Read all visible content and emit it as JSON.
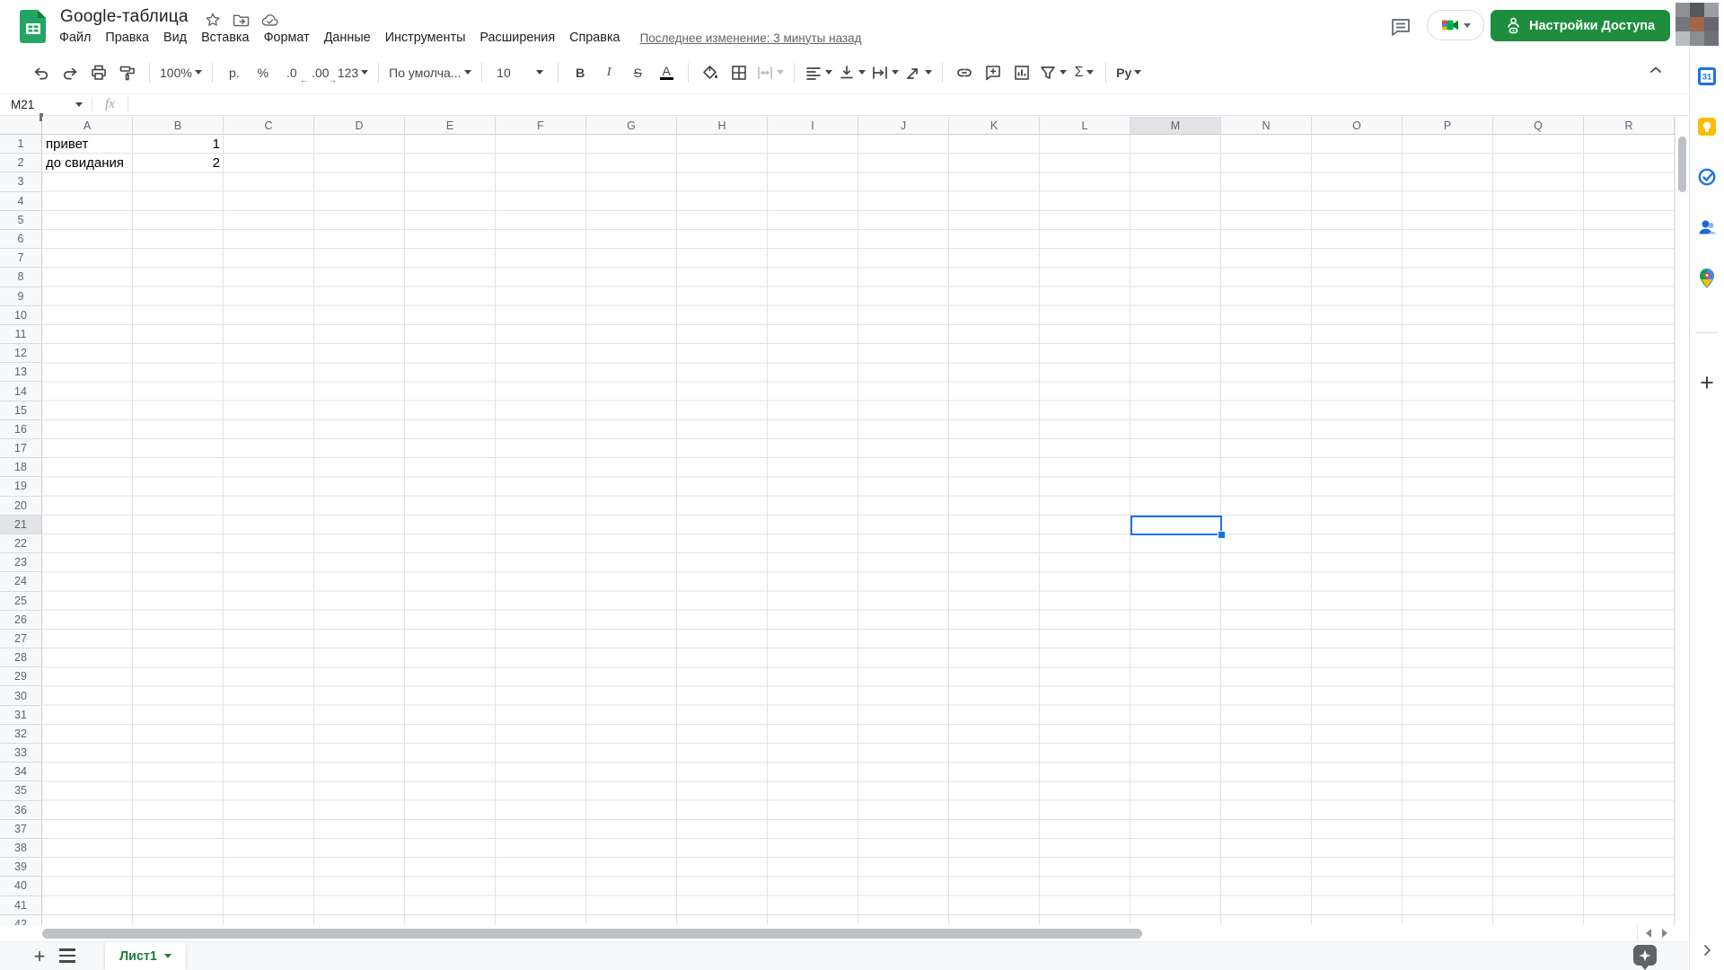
{
  "header": {
    "title": "Google-таблица",
    "menu_items": [
      "Файл",
      "Правка",
      "Вид",
      "Вставка",
      "Формат",
      "Данные",
      "Инструменты",
      "Расширения",
      "Справка"
    ],
    "last_edit": "Последнее изменение: 3 минуты назад",
    "share_button_label": "Настройки Доступа"
  },
  "toolbar": {
    "zoom_value": "100%",
    "currency_label": "р.",
    "percent_label": "%",
    "decrease_decimal_label": ".0",
    "increase_decimal_label": ".00",
    "number_format_label": "123",
    "font_name": "По умолча...",
    "font_size": "10",
    "bold_label": "B",
    "italic_label": "I",
    "strikethrough_label": "S",
    "text_color_label": "A",
    "functions_label": "Σ",
    "input_tools_label": "Ру"
  },
  "formula_bar": {
    "name_box_value": "M21",
    "fx_label": "fx",
    "formula_value": ""
  },
  "grid": {
    "column_letters": [
      "A",
      "B",
      "C",
      "D",
      "E",
      "F",
      "G",
      "H",
      "I",
      "J",
      "K",
      "L",
      "M",
      "N",
      "O",
      "P",
      "Q",
      "R"
    ],
    "visible_row_count": 42,
    "cells": [
      {
        "ref": "A1",
        "col": "A",
        "row": 1,
        "value": "привет",
        "align": "left"
      },
      {
        "ref": "B1",
        "col": "B",
        "row": 1,
        "value": "1",
        "align": "right"
      },
      {
        "ref": "A2",
        "col": "A",
        "row": 2,
        "value": "до свидания",
        "align": "left"
      },
      {
        "ref": "B2",
        "col": "B",
        "row": 2,
        "value": "2",
        "align": "right"
      }
    ],
    "selected_cell": {
      "ref": "M21",
      "col": "M",
      "row": 21
    }
  },
  "sheet_bar": {
    "active_sheet": "Лист1"
  },
  "colors": {
    "selection_blue": "#1a73e8",
    "share_green": "#1e8e3e",
    "sheet_tab_green": "#188038",
    "logo_green": "#23a566",
    "logo_fold_green": "#188038"
  }
}
